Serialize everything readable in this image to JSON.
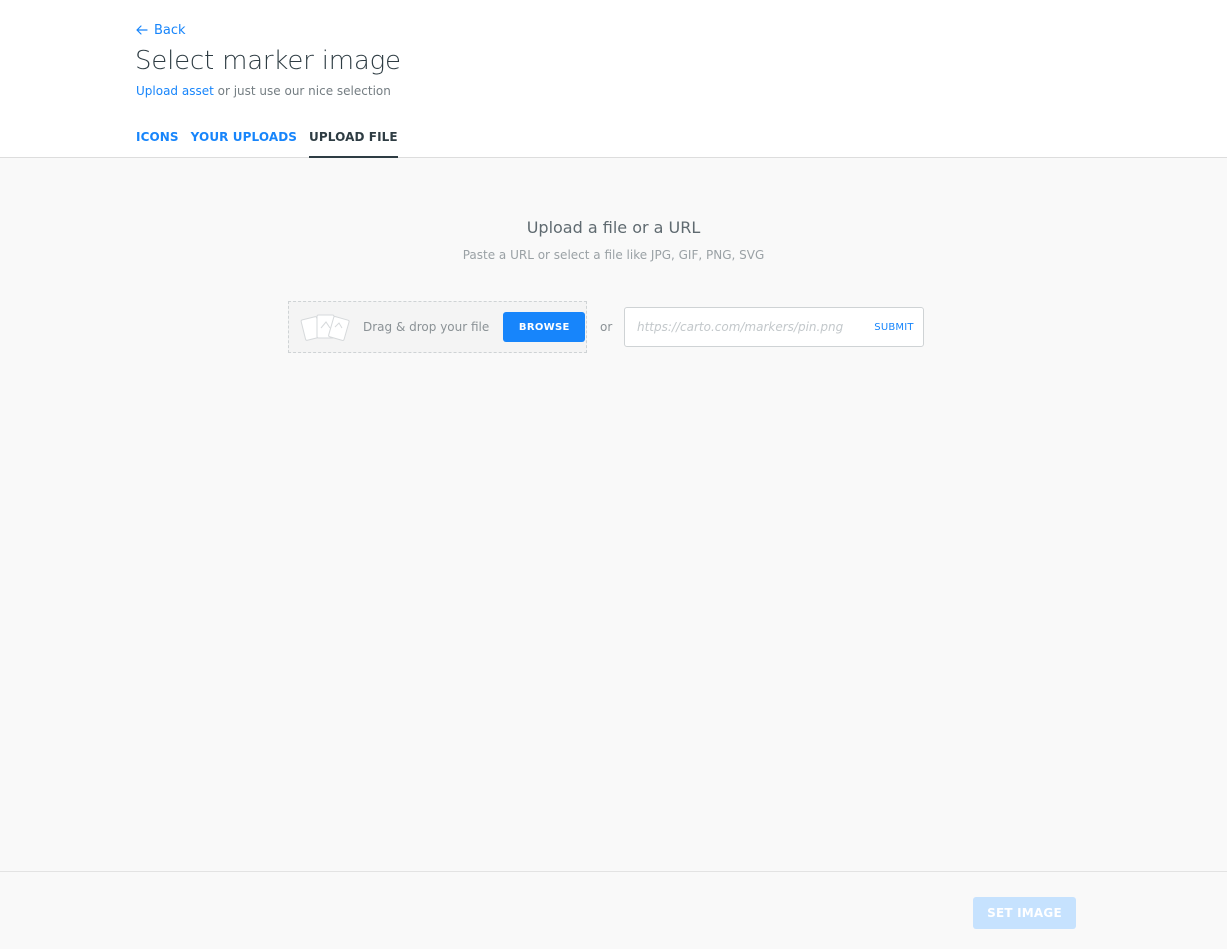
{
  "header": {
    "back_label": "Back",
    "title": "Select marker image",
    "subtitle_link": "Upload asset",
    "subtitle_rest": " or just use our nice selection"
  },
  "tabs": [
    {
      "label": "ICONS",
      "active": false
    },
    {
      "label": "YOUR UPLOADS",
      "active": false
    },
    {
      "label": "UPLOAD FILE",
      "active": true
    }
  ],
  "upload": {
    "title": "Upload a file or a URL",
    "subtitle": "Paste a URL or select a file like JPG, GIF, PNG, SVG",
    "drop_text": "Drag & drop your file",
    "browse_label": "BROWSE",
    "or_label": "or",
    "url_placeholder": "https://carto.com/markers/pin.png",
    "url_value": "",
    "submit_label": "SUBMIT"
  },
  "footer": {
    "set_image_label": "SET IMAGE"
  },
  "colors": {
    "accent": "#1785fb",
    "text": "#2e3c43",
    "disabled_button": "#c6e2fe"
  },
  "icons": [
    "arrow-left-icon",
    "files-icon"
  ]
}
